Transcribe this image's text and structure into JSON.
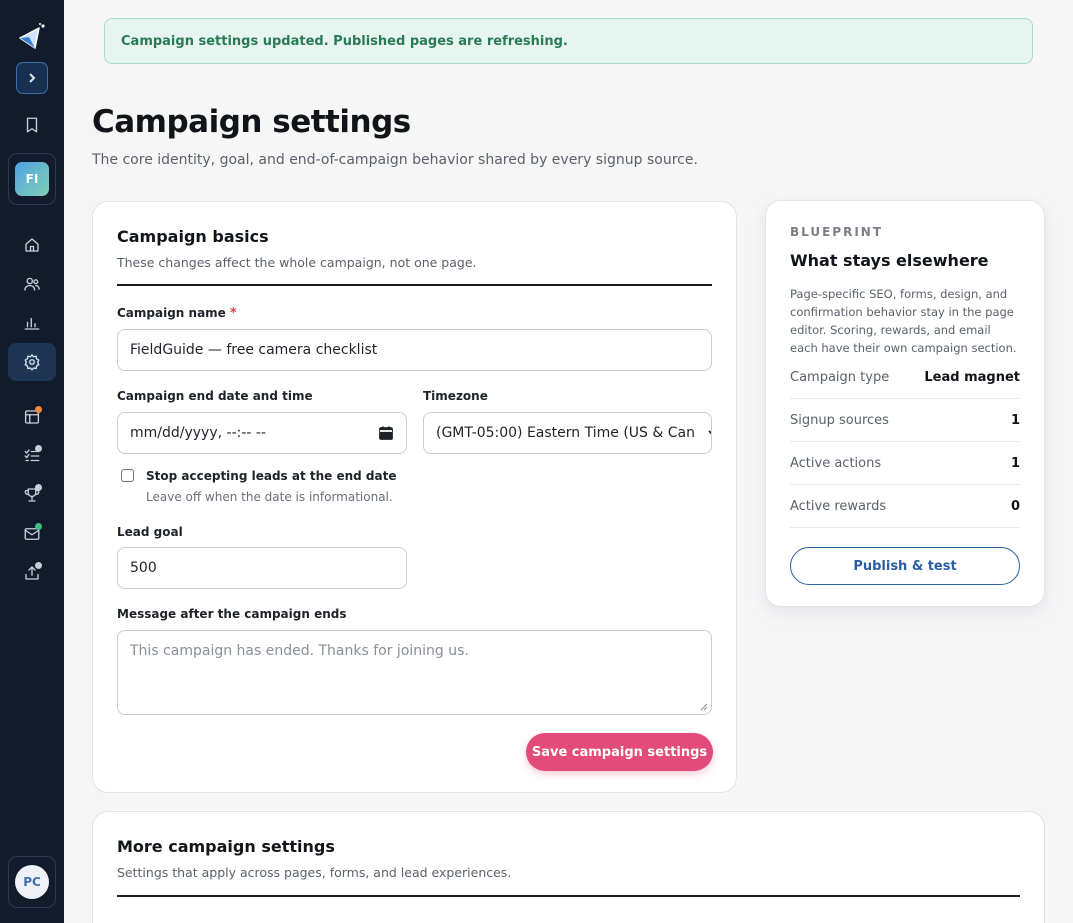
{
  "banner": {
    "text": "Campaign settings updated. Published pages are refreshing."
  },
  "header": {
    "title": "Campaign settings",
    "subtitle": "The core identity, goal, and end-of-campaign behavior shared by every signup source."
  },
  "sidebar": {
    "workspace_initials": "FI",
    "user_initials": "PC",
    "icons": [
      "expand-icon",
      "bookmark-icon",
      "home-icon",
      "users-icon",
      "chart-icon",
      "settings-icon",
      "layout-icon",
      "checklist-icon",
      "trophy-icon",
      "mail-icon",
      "upload-icon"
    ],
    "dot_colors": {
      "orange": "#f08a3c",
      "gray": "#c9ced6",
      "green": "#3fc27f"
    }
  },
  "basics": {
    "title": "Campaign basics",
    "subtitle": "These changes affect the whole campaign, not one page.",
    "name_label": "Campaign name",
    "required_mark": "*",
    "name_value": "FieldGuide — free camera checklist",
    "end_label": "Campaign end date and time",
    "end_placeholder": "mm/dd/yyyy, --:-- --",
    "timezone_label": "Timezone",
    "timezone_value": "(GMT-05:00) Eastern Time (US & Can",
    "stop_label": "Stop accepting leads at the end date",
    "stop_hint": "Leave off when the date is informational.",
    "stop_checked": false,
    "goal_label": "Lead goal",
    "goal_value": "500",
    "message_label": "Message after the campaign ends",
    "message_placeholder": "This campaign has ended. Thanks for joining us.",
    "save_label": "Save campaign settings"
  },
  "blueprint": {
    "eyebrow": "BLUEPRINT",
    "title": "What stays elsewhere",
    "description": "Page-specific SEO, forms, design, and confirmation behavior stay in the page editor. Scoring, rewards, and email each have their own campaign section.",
    "rows": [
      {
        "key": "Campaign type",
        "value": "Lead magnet"
      },
      {
        "key": "Signup sources",
        "value": "1"
      },
      {
        "key": "Active actions",
        "value": "1"
      },
      {
        "key": "Active rewards",
        "value": "0"
      }
    ],
    "button_label": "Publish & test"
  },
  "more": {
    "title": "More campaign settings",
    "subtitle": "Settings that apply across pages, forms, and lead experiences."
  },
  "colors": {
    "accent": "#e34b7a",
    "sidebar": "#121b2b",
    "success": "#2b7a57",
    "link": "#2b5fa3"
  }
}
